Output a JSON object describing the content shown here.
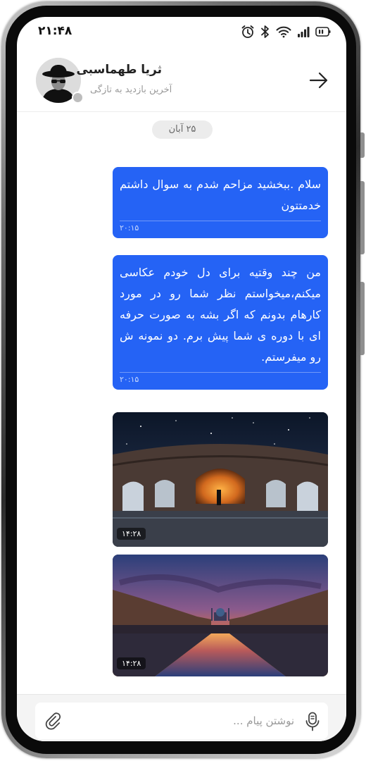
{
  "status_bar": {
    "time": "۲۱:۴۸",
    "icons": [
      "alarm-icon",
      "bluetooth-icon",
      "wifi-icon",
      "signal-icon",
      "battery-icon"
    ]
  },
  "header": {
    "contact_name": "ثریا طهماسبی",
    "last_seen": "آخرین بازدید به تازگی",
    "back_icon": "arrow-right-icon",
    "presence": "offline"
  },
  "chat": {
    "date_label": "۲۵ آبان",
    "messages": [
      {
        "type": "text",
        "text": "سلام .ببخشید مزاحم شدم به سوال داشتم خدمتتون",
        "time": "۲۰:۱۵"
      },
      {
        "type": "text",
        "text": "من چند وقتیه برای دل خودم عکاسی میکنم،میخواستم نظر شما رو در مورد کارهام بدونم که اگر بشه به صورت حرفه ای با دوره ی شما پیش برم. دو نمونه ش رو میفرستم.",
        "time": "۲۰:۱۵"
      },
      {
        "type": "image",
        "subject": "night-ruins-photo",
        "time": "۱۴:۲۸"
      },
      {
        "type": "image",
        "subject": "sunset-square-photo",
        "time": "۱۴:۲۸"
      }
    ]
  },
  "composer": {
    "placeholder": "نوشتن پیام ...",
    "value": "",
    "mic_icon": "microphone-icon",
    "attach_icon": "attachment-icon"
  },
  "colors": {
    "bubble": "#2563f5",
    "date_pill": "#ececec",
    "background": "#ffffff"
  }
}
